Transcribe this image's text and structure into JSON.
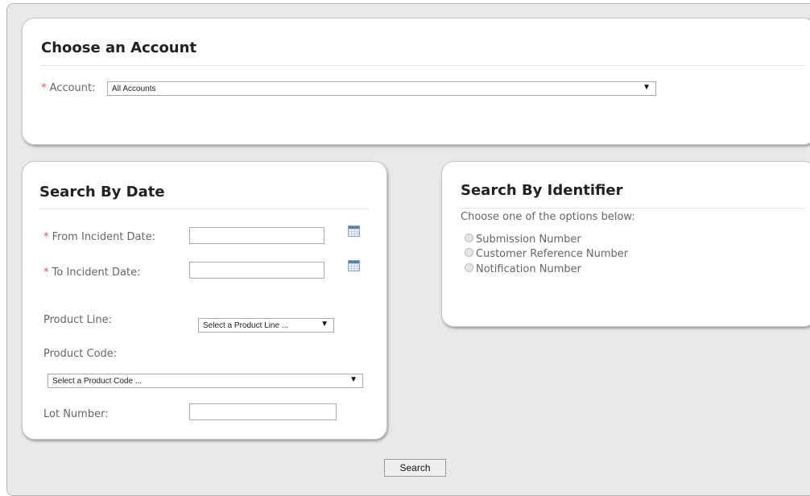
{
  "account_panel": {
    "title": "Choose an Account",
    "required_marker": "*",
    "account_label": "Account:",
    "account_value": "All Accounts",
    "dropdown_arrow": "▼"
  },
  "date_panel": {
    "title": "Search By Date",
    "required_marker": "*",
    "from_label": "From Incident Date:",
    "from_value": "",
    "to_label": "To Incident Date:",
    "to_value": "",
    "product_line_label": "Product Line:",
    "product_line_value": "Select a Product Line ...",
    "product_code_label": "Product Code:",
    "product_code_value": "Select a Product Code ...",
    "lot_label": "Lot Number:",
    "lot_value": "",
    "dropdown_arrow": "▼"
  },
  "identifier_panel": {
    "title": "Search By Identifier",
    "instructions": "Choose one of the options below:",
    "options": [
      "Submission Number",
      "Customer Reference Number",
      "Notification Number"
    ]
  },
  "search_button": "Search",
  "icons": {
    "calendar": "calendar-icon",
    "radio": "radio-unselected"
  }
}
